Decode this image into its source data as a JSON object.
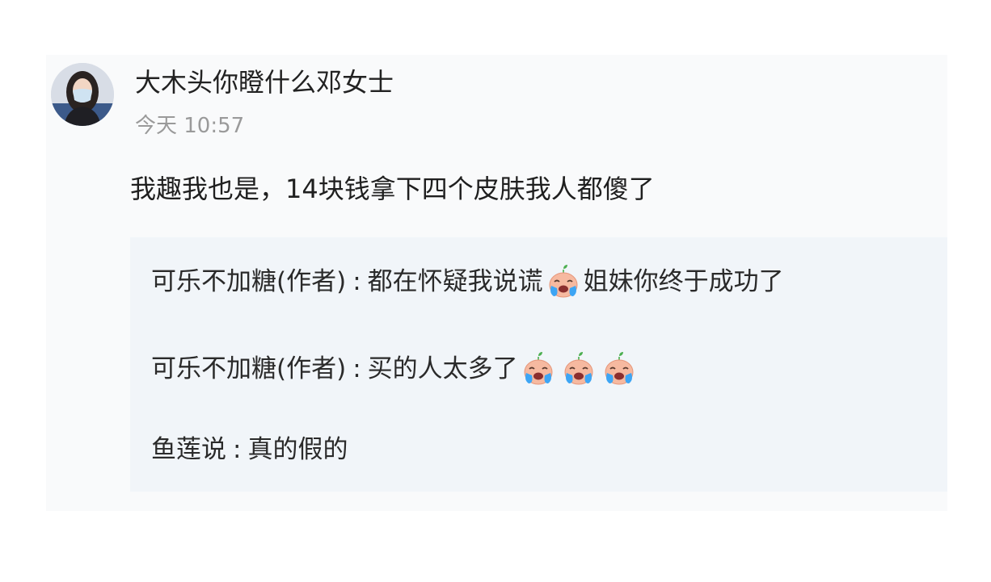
{
  "comment": {
    "username": "大木头你瞪什么邓女士",
    "timestamp": "今天 10:57",
    "text": "我趣我也是，14块钱拿下四个皮肤我人都傻了"
  },
  "replies": [
    {
      "author": "可乐不加糖(作者)",
      "separator": ":",
      "text_before": "都在怀疑我说谎",
      "emoji": [
        "crying-sprout-emoji"
      ],
      "text_after": "姐妹你终于成功了"
    },
    {
      "author": "可乐不加糖(作者)",
      "separator": ":",
      "text_before": "买的人太多了",
      "emoji": [
        "crying-sprout-emoji",
        "crying-sprout-emoji",
        "crying-sprout-emoji"
      ],
      "text_after": ""
    },
    {
      "author": "鱼莲说",
      "separator": ":",
      "text_before": "真的假的",
      "emoji": [],
      "text_after": ""
    }
  ],
  "colors": {
    "card_bg": "#f9fafb",
    "reply_bg": "#f1f5f9",
    "timestamp": "#9a9a9a",
    "text": "#222222"
  }
}
